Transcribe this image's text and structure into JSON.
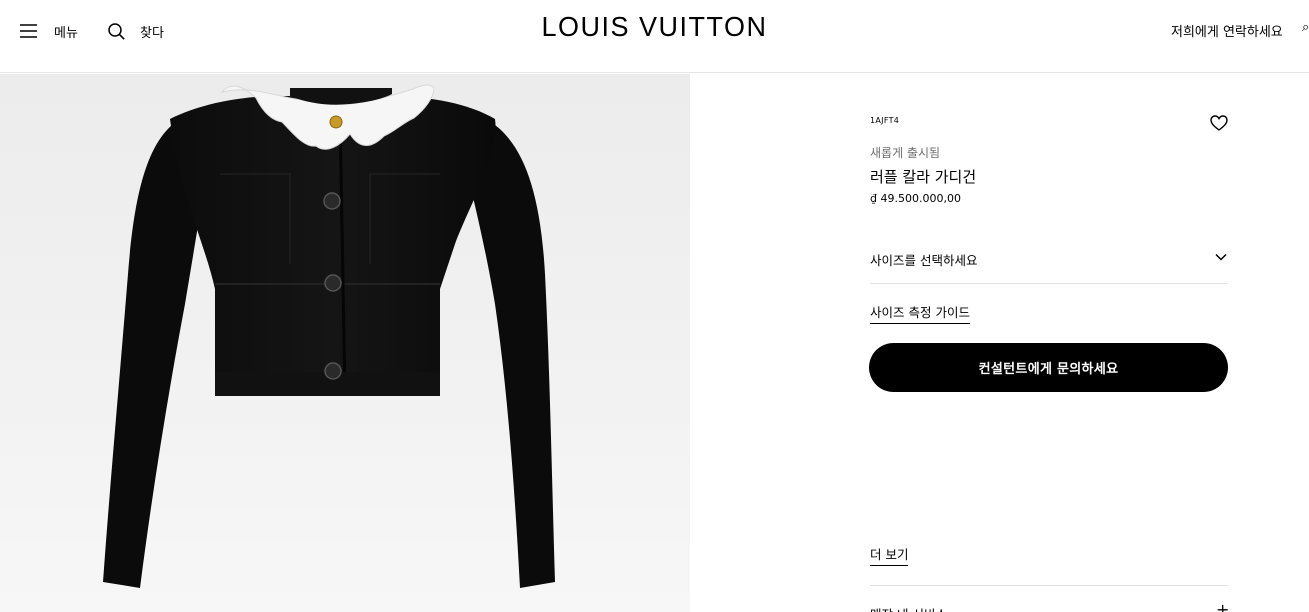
{
  "header": {
    "menu_label": "메뉴",
    "search_label": "찾다",
    "logo": "LOUIS VUITTON",
    "contact_label": "저희에게 연락하세요"
  },
  "product": {
    "sku": "1AJFT4",
    "status": "새롭게 출시됨",
    "name": "러플 칼라 가디건",
    "price": "₫ 49.500.000,00",
    "size_select_label": "사이즈를 선택하세요",
    "size_guide_label": "사이즈 측정 가이드",
    "cta_label": "컨설턴트에게 문의하세요",
    "more_label": "더 보기",
    "store_service_label": "매장 내 서비스"
  },
  "icons": {
    "menu": "hamburger-icon",
    "search": "search-icon",
    "wishlist": "heart-icon",
    "size_chevron": "chevron-down-icon",
    "expand": "plus-icon"
  },
  "colors": {
    "accent": "#000000",
    "muted_text": "#6f6f6f",
    "image_bg": "#efefef"
  }
}
